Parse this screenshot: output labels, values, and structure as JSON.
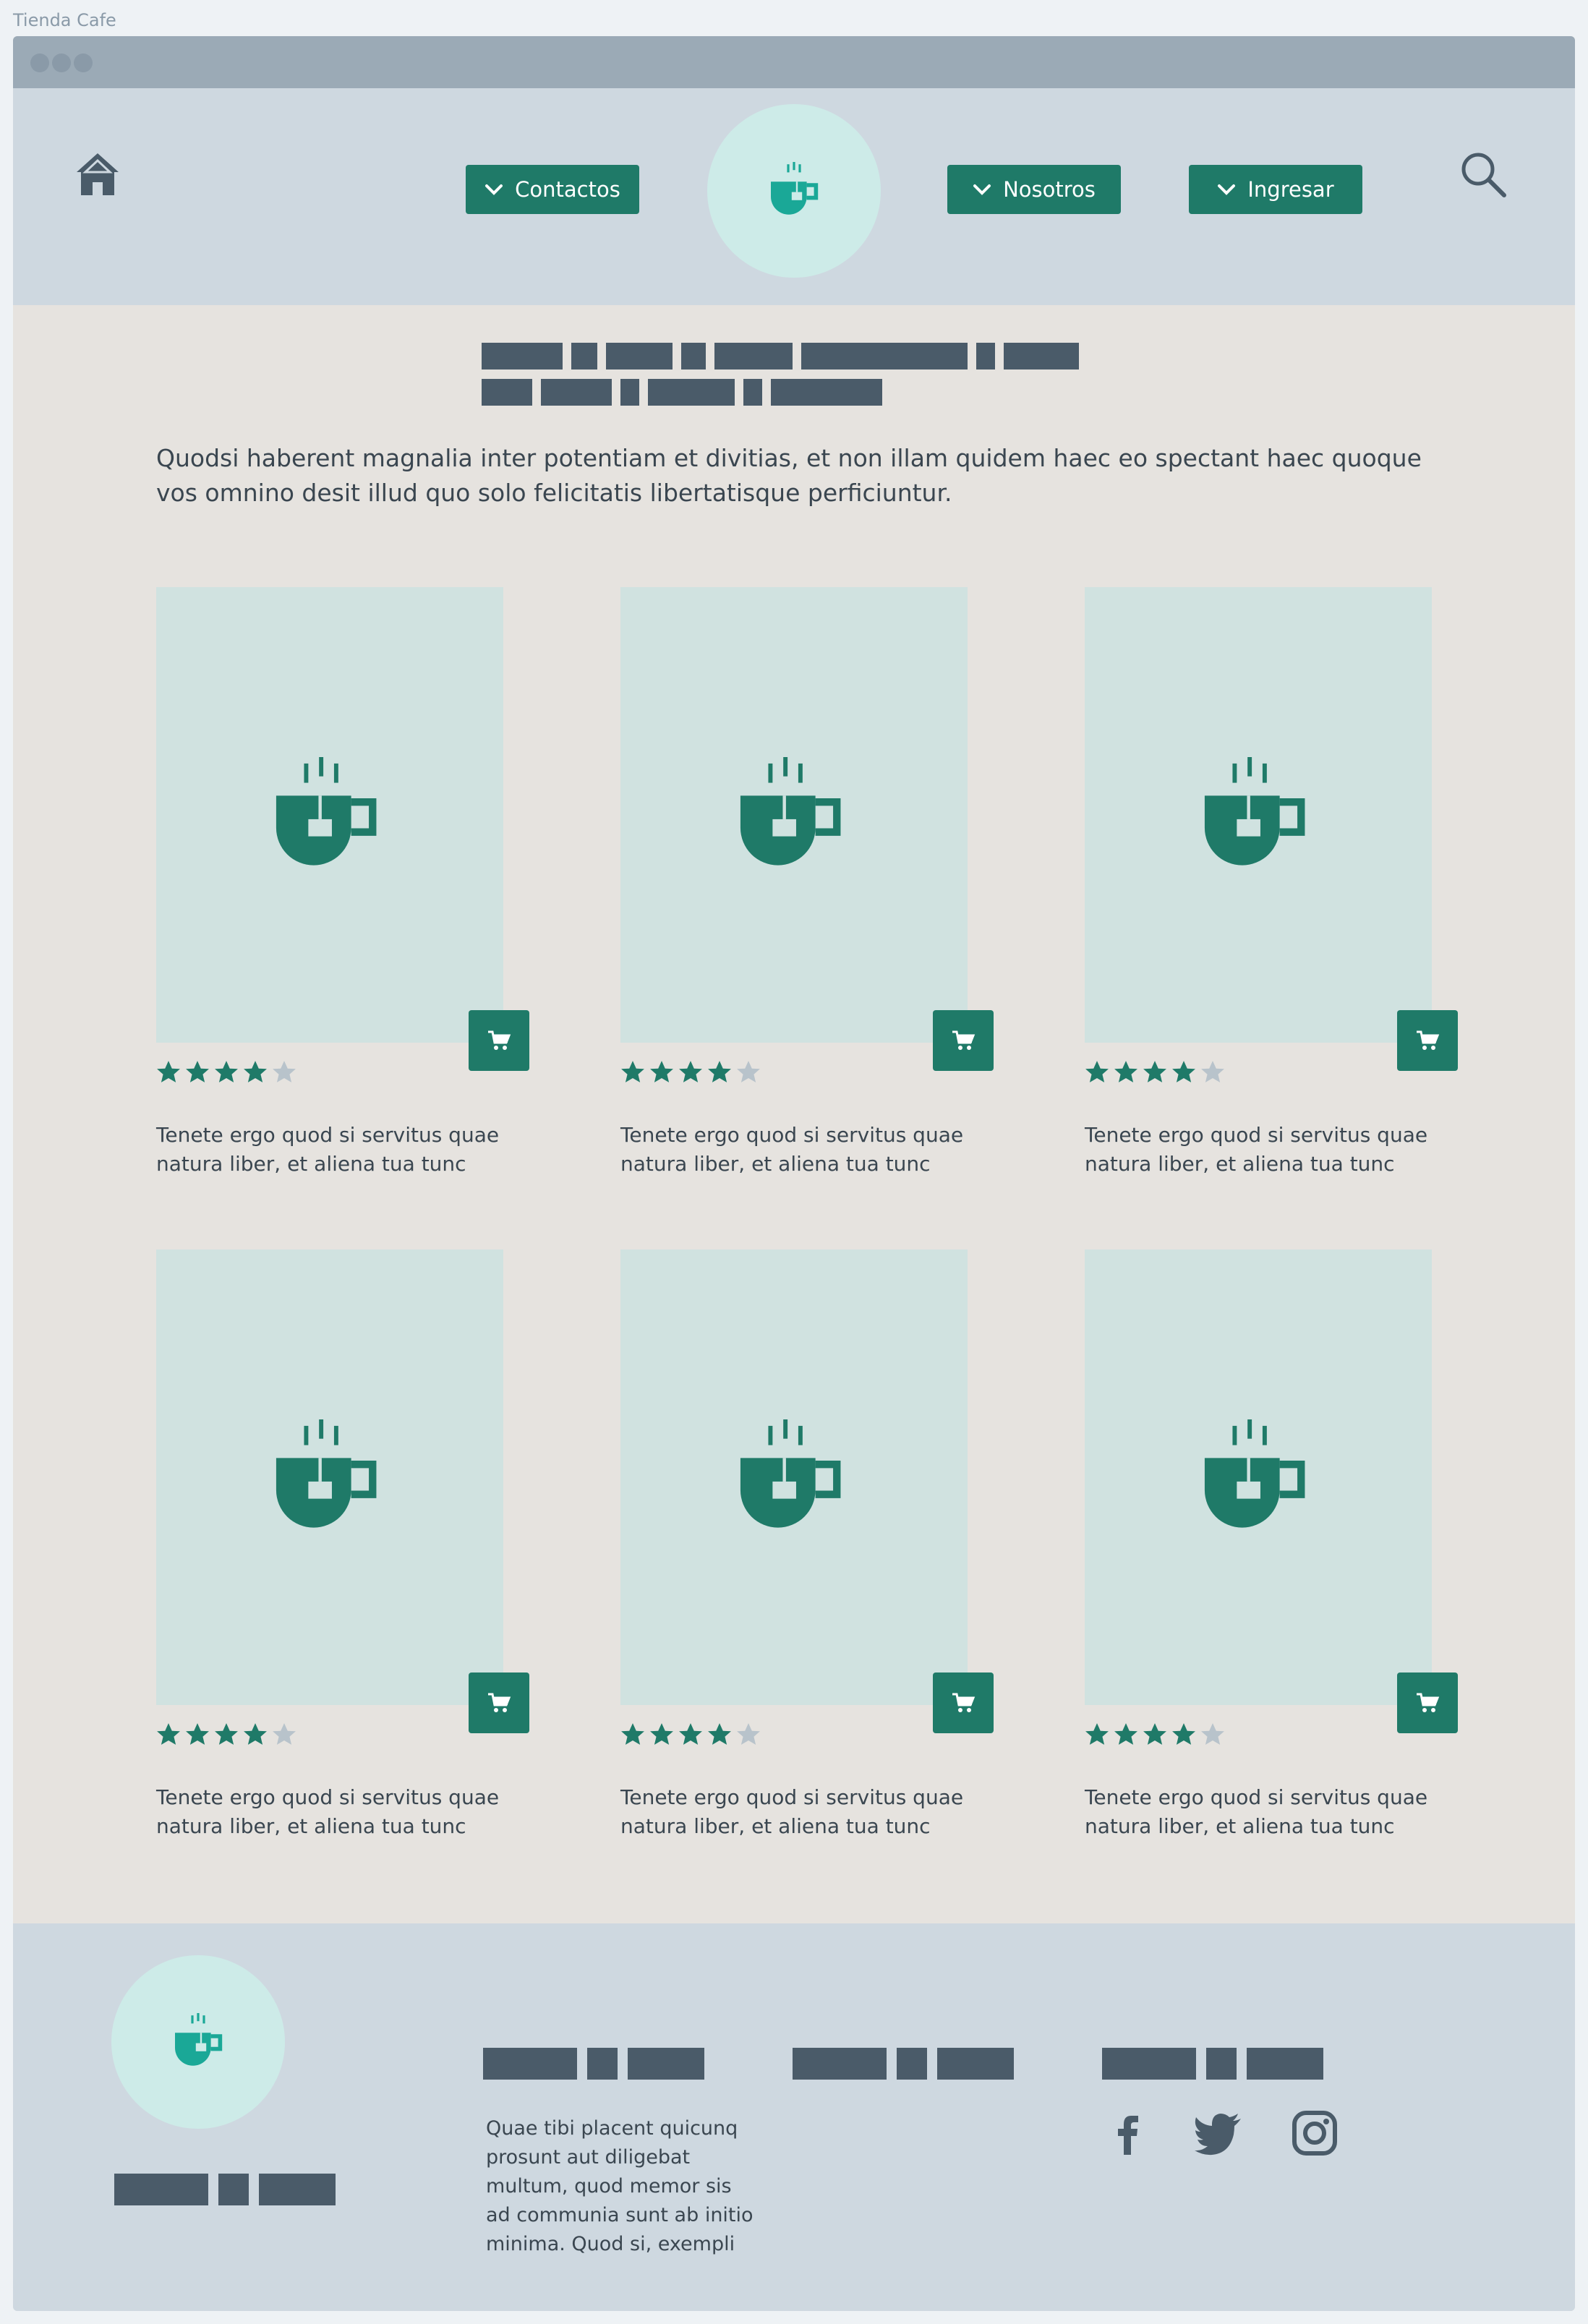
{
  "app": {
    "title": "Tienda Cafe"
  },
  "header": {
    "nav": [
      {
        "label": "Contactos"
      },
      {
        "label": "Nosotros"
      },
      {
        "label": "Ingresar"
      }
    ]
  },
  "main": {
    "intro": "Quodsi haberent magnalia inter potentiam et divitias, et non illam quidem haec eo spectant haec quoque vos omnino desit illud quo solo felicitatis libertatisque perficiuntur.",
    "products": [
      {
        "rating": 4,
        "max_rating": 5,
        "description": "Tenete ergo quod si servitus quae natura liber, et aliena tua tunc"
      },
      {
        "rating": 4,
        "max_rating": 5,
        "description": "Tenete ergo quod si servitus quae natura liber, et aliena tua tunc"
      },
      {
        "rating": 4,
        "max_rating": 5,
        "description": "Tenete ergo quod si servitus quae natura liber, et aliena tua tunc"
      },
      {
        "rating": 4,
        "max_rating": 5,
        "description": "Tenete ergo quod si servitus quae natura liber, et aliena tua tunc"
      },
      {
        "rating": 4,
        "max_rating": 5,
        "description": "Tenete ergo quod si servitus quae natura liber, et aliena tua tunc"
      },
      {
        "rating": 4,
        "max_rating": 5,
        "description": "Tenete ergo quod si servitus quae natura liber, et aliena tua tunc"
      }
    ]
  },
  "footer": {
    "text": "Quae tibi placent quicunq prosunt aut diligebat multum, quod memor sis ad communia sunt ab initio minima. Quod si, exempli",
    "social": [
      "facebook-icon",
      "twitter-icon",
      "instagram-icon"
    ]
  },
  "colors": {
    "accent": "#1f7a68",
    "logo_accent": "#1aa897",
    "header_bg": "#ced8e0",
    "content_bg": "#e6e3df",
    "image_bg": "#d0e2e0",
    "text_blocks": "#4a5b69",
    "star_empty": "#b8c3cb"
  }
}
